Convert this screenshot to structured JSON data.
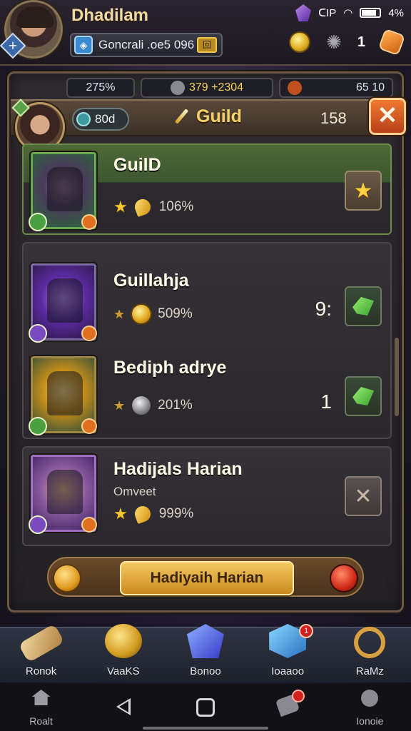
{
  "header": {
    "player_name": "Dhadilam",
    "status_signal": "ᑕIP",
    "battery": "4%",
    "server_name": "Goncrali .oe5 096",
    "server_badge": "回",
    "top_count": "1"
  },
  "panel": {
    "stats": [
      "275%",
      "379 +2304",
      "65 10"
    ],
    "level": "80d",
    "title": "Guild",
    "count": "158",
    "close_label": "✕"
  },
  "rows": [
    {
      "title": "GuilD",
      "subtitle": "",
      "percent": "106%",
      "number": "",
      "action": "★"
    },
    {
      "title": "Guillahja",
      "subtitle": "",
      "percent": "509%",
      "number": "9:",
      "action": ""
    },
    {
      "title": "Bediph adrye",
      "subtitle": "",
      "percent": "201%",
      "number": "1",
      "action": ""
    },
    {
      "title": "Hadijals Harian",
      "subtitle": "Omveet",
      "percent": "999%",
      "number": "",
      "action": "✕"
    }
  ],
  "banner": {
    "button_label": "Hadiyaih Harian"
  },
  "game_nav": [
    {
      "label": "Ronok",
      "icon": "scroll-icon",
      "badge": ""
    },
    {
      "label": "VaaKS",
      "icon": "golden-mask-icon",
      "badge": ""
    },
    {
      "label": "Bonoo",
      "icon": "blue-gem-icon",
      "badge": ""
    },
    {
      "label": "Ioaaoo",
      "icon": "cube-icon",
      "badge": "1"
    },
    {
      "label": "RaMz",
      "icon": "ring-icon",
      "badge": ""
    }
  ],
  "system_nav": [
    {
      "label": "Roalt",
      "icon": "home-icon"
    },
    {
      "label": "",
      "icon": "back-icon"
    },
    {
      "label": "",
      "icon": "recent-apps-icon"
    },
    {
      "label": "",
      "icon": "chat-icon"
    },
    {
      "label": "Ionoie",
      "icon": "person-icon"
    }
  ],
  "colors": {
    "accent_gold": "#f5cf6a",
    "close_orange": "#e06a28",
    "featured_green": "#4f6a38",
    "panel_bg": "#2e2b2e"
  }
}
